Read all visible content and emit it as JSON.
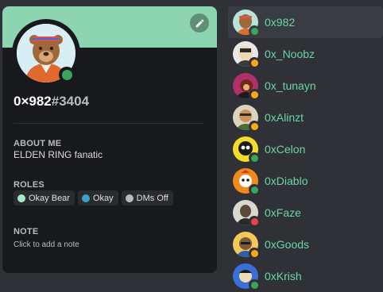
{
  "profile": {
    "banner_color": "#8dd5b0",
    "username": "0×982",
    "discriminator": "#3404",
    "status_color": "#3ba55c",
    "about_heading": "ABOUT ME",
    "about_text": "ELDEN RING fanatic",
    "roles_heading": "ROLES",
    "roles": [
      {
        "label": "Okay Bear",
        "color": "#a6e9c8"
      },
      {
        "label": "Okay",
        "color": "#3ba0c9"
      },
      {
        "label": "DMs Off",
        "color": "#b9bbbe"
      }
    ],
    "note_heading": "NOTE",
    "note_placeholder": "Click to add a note",
    "edit_icon": "pencil-icon"
  },
  "members": [
    {
      "name": "0x982",
      "status": "online",
      "status_color": "#3ba55c",
      "avatar_bg": "#b7e4d8",
      "selected": true
    },
    {
      "name": "0x_Noobz",
      "status": "idle",
      "status_color": "#faa81a",
      "avatar_bg": "#e8e8e8"
    },
    {
      "name": "0x_tunayn",
      "status": "idle",
      "status_color": "#faa81a",
      "avatar_bg": "#b0306a"
    },
    {
      "name": "0xAlinzt",
      "status": "idle",
      "status_color": "#faa81a",
      "avatar_bg": "#d9d4c0"
    },
    {
      "name": "0xCelon",
      "status": "online",
      "status_color": "#3ba55c",
      "avatar_bg": "#f4dd2a"
    },
    {
      "name": "0xDiablo",
      "status": "online",
      "status_color": "#3ba55c",
      "avatar_bg": "#f08a1c"
    },
    {
      "name": "0xFaze",
      "status": "dnd",
      "status_color": "#ed4245",
      "avatar_bg": "#d8d8d0"
    },
    {
      "name": "0xGoods",
      "status": "idle",
      "status_color": "#faa81a",
      "avatar_bg": "#f3c85a"
    },
    {
      "name": "0xKrish",
      "status": "online",
      "status_color": "#3ba55c",
      "avatar_bg": "#3a6fd8"
    }
  ]
}
